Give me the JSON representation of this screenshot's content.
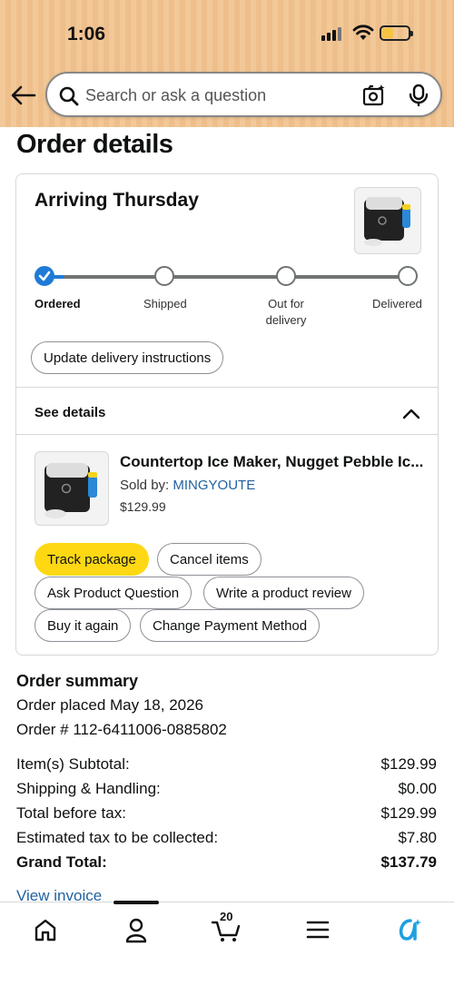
{
  "status_bar": {
    "time": "1:06",
    "accent": "#f2c898"
  },
  "search": {
    "placeholder": "Search or ask a question"
  },
  "page": {
    "title": "Order details"
  },
  "shipment": {
    "arriving": "Arriving Thursday",
    "steps": [
      "Ordered",
      "Shipped",
      "Out for delivery",
      "Delivered"
    ],
    "current_step": 0,
    "update_instructions": "Update delivery instructions",
    "see_details": "See details",
    "item": {
      "title": "Countertop Ice Maker, Nugget Pebble Ic...",
      "sold_by_label": "Sold by:",
      "seller": "MINGYOUTE",
      "price": "$129.99"
    },
    "actions": {
      "track": "Track package",
      "cancel": "Cancel items",
      "ask": "Ask Product Question",
      "review": "Write a product review",
      "buy_again": "Buy it again",
      "change_payment": "Change Payment Method"
    }
  },
  "summary": {
    "heading": "Order summary",
    "placed": "Order placed May 18, 2026",
    "order_number": "Order # 112-6411006-0885802",
    "rows": [
      {
        "label": "Item(s) Subtotal:",
        "value": "$129.99"
      },
      {
        "label": "Shipping & Handling:",
        "value": "$0.00"
      },
      {
        "label": "Total before tax:",
        "value": "$129.99"
      },
      {
        "label": "Estimated tax to be collected:",
        "value": "$7.80"
      },
      {
        "label": "Grand Total:",
        "value": "$137.79"
      }
    ],
    "view_invoice": "View invoice"
  },
  "bottom_nav": {
    "items": [
      "home-icon",
      "account-icon",
      "cart-icon",
      "menu-icon",
      "rufus-icon"
    ],
    "cart_count": "20",
    "active": "account-icon"
  },
  "colors": {
    "link": "#2162a1",
    "progress": "#1f7ad6",
    "button_yellow": "#ffd814",
    "rufus": "#1ea0e0"
  }
}
